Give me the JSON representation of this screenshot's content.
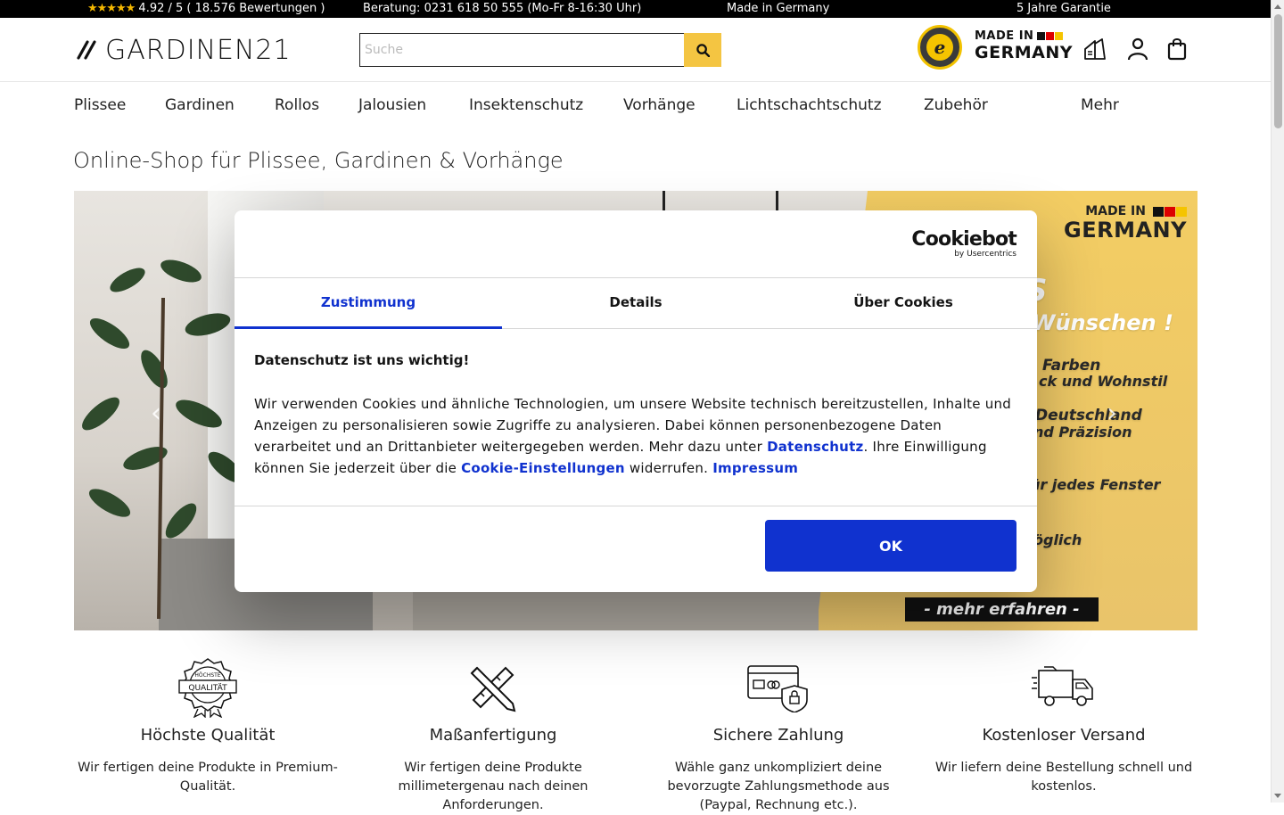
{
  "topbar": {
    "stars": "★★★★★",
    "rating": "4.92 / 5 ( 18.576 Bewertungen )",
    "beratung": "Beratung: 0231 618 50 555 (Mo-Fr 8-16:30 Uhr)",
    "made": "Made in Germany",
    "garantie": "5 Jahre Garantie"
  },
  "header": {
    "logo_text": "GARDINEN21",
    "search_placeholder": "Suche",
    "trust_badge_text": "e",
    "made_in_line1": "MADE IN",
    "made_in_line2": "GERMANY",
    "flag_colors": [
      "#111111",
      "#dd0000",
      "#f5c400"
    ]
  },
  "nav": {
    "items": [
      "Plissee",
      "Gardinen",
      "Rollos",
      "Jalousien",
      "Insektenschutz",
      "Vorhänge",
      "Lichtschachtschutz",
      "Zubehör",
      "Mehr"
    ]
  },
  "page": {
    "title": "Online-Shop für Plissee, Gardinen & Vorhänge"
  },
  "hero": {
    "made_in_line1": "MADE IN",
    "made_in_line2": "GERMANY",
    "lines": [
      "S",
      "Wünschen !",
      "Farben",
      "ck und Wohnstil",
      "Deutschland",
      "nd Präzision",
      "ür jedes Fenster",
      "öglich"
    ],
    "cta": "- mehr erfahren -"
  },
  "features": [
    {
      "icon": "quality-badge-icon",
      "badge_top": "HÖCHSTE",
      "badge_main": "QUALITÄT",
      "title": "Höchste Qualität",
      "text": "Wir fertigen deine Produkte in Premium-Qualität."
    },
    {
      "icon": "ruler-pencil-icon",
      "title": "Maßanfertigung",
      "text": "Wir fertigen deine Produkte millimetergenau nach deinen Anforderungen."
    },
    {
      "icon": "secure-payment-icon",
      "title": "Sichere Zahlung",
      "text": "Wähle ganz unkompliziert deine bevorzugte Zahlungsmethode aus (Paypal, Rechnung etc.)."
    },
    {
      "icon": "delivery-truck-icon",
      "title": "Kostenloser Versand",
      "text": "Wir liefern deine Bestellung schnell und kostenlos."
    }
  ],
  "cookie": {
    "brand": "Cookiebot",
    "brand_sub": "by Usercentrics",
    "tabs": [
      "Zustimmung",
      "Details",
      "Über Cookies"
    ],
    "heading": "Datenschutz ist uns wichtig!",
    "text_1": "Wir verwenden Cookies und ähnliche Technologien, um unsere Website technisch bereitzustellen, Inhalte und Anzeigen zu personalisieren sowie Zugriffe zu analysieren. Dabei können personenbezogene Daten verarbeitet und an Drittanbieter weitergegeben werden. Mehr dazu unter ",
    "link_datenschutz": "Datenschutz",
    "text_2": ". Ihre Einwilligung können Sie jederzeit über die ",
    "link_einstellungen": "Cookie-Einstellungen",
    "text_3": " widerrufen. ",
    "link_impressum": "Impressum",
    "ok": "OK"
  },
  "colors": {
    "accent_yellow": "#f4c542",
    "cookie_blue": "#1032cf"
  }
}
